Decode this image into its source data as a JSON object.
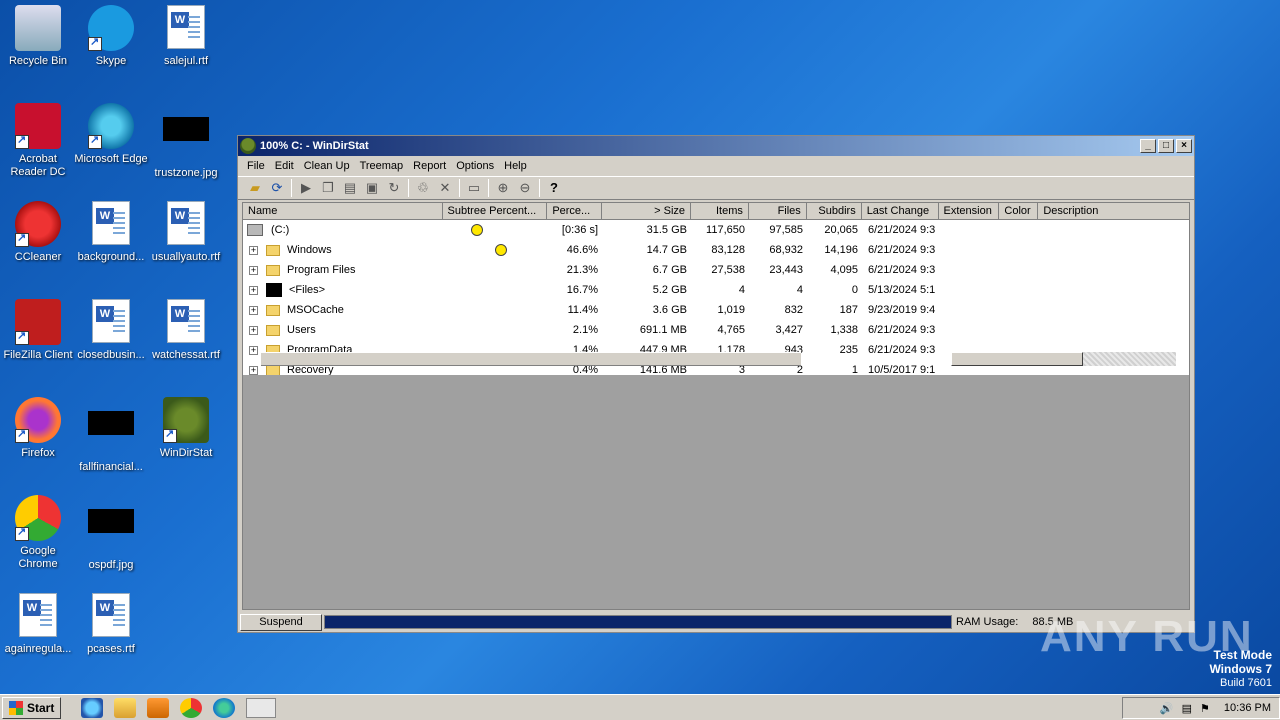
{
  "desktop_icons": [
    {
      "label": "Recycle Bin",
      "icon": "recycle-bin-icon"
    },
    {
      "label": "Skype",
      "icon": "skype-icon"
    },
    {
      "label": "salejul.rtf",
      "icon": "word-doc-icon"
    },
    {
      "label": "Acrobat Reader DC",
      "icon": "acrobat-icon"
    },
    {
      "label": "Microsoft Edge",
      "icon": "edge-icon"
    },
    {
      "label": "trustzone.jpg",
      "icon": "image-icon"
    },
    {
      "label": "CCleaner",
      "icon": "ccleaner-icon"
    },
    {
      "label": "background...",
      "icon": "word-doc-icon"
    },
    {
      "label": "usuallyauto.rtf",
      "icon": "word-doc-icon"
    },
    {
      "label": "FileZilla Client",
      "icon": "filezilla-icon"
    },
    {
      "label": "closedbusin...",
      "icon": "word-doc-icon"
    },
    {
      "label": "watchessat.rtf",
      "icon": "word-doc-icon"
    },
    {
      "label": "Firefox",
      "icon": "firefox-icon"
    },
    {
      "label": "fallfinancial...",
      "icon": "image-icon"
    },
    {
      "label": "WinDirStat",
      "icon": "windirstat-icon"
    },
    {
      "label": "Google Chrome",
      "icon": "chrome-icon"
    },
    {
      "label": "ospdf.jpg",
      "icon": "image-icon"
    },
    {
      "label": "againregula...",
      "icon": "word-doc-icon"
    },
    {
      "label": "pcases.rtf",
      "icon": "word-doc-icon"
    }
  ],
  "window": {
    "title": "100% C: - WinDirStat",
    "menu": [
      "File",
      "Edit",
      "Clean Up",
      "Treemap",
      "Report",
      "Options",
      "Help"
    ],
    "columns": [
      "Name",
      "Subtree Percent...",
      "Perce...",
      "> Size",
      "Items",
      "Files",
      "Subdirs",
      "Last Change",
      "Extension",
      "Color",
      "Description"
    ],
    "rows": [
      {
        "name": "(C:)",
        "expand": "",
        "perc": "[0:36 s]",
        "size": "31.5 GB",
        "items": "117,650",
        "files": "97,585",
        "subdirs": "20,065",
        "changed": "6/21/2024  9:3",
        "fill": 100
      },
      {
        "name": "Windows",
        "expand": "+",
        "perc": "46.6%",
        "size": "14.7 GB",
        "items": "83,128",
        "files": "68,932",
        "subdirs": "14,196",
        "changed": "6/21/2024  9:3",
        "fill": 46.6
      },
      {
        "name": "Program Files",
        "expand": "+",
        "perc": "21.3%",
        "size": "6.7 GB",
        "items": "27,538",
        "files": "23,443",
        "subdirs": "4,095",
        "changed": "6/21/2024  9:3",
        "fill": 21.3
      },
      {
        "name": "<Files>",
        "expand": "+",
        "perc": "16.7%",
        "size": "5.2 GB",
        "items": "4",
        "files": "4",
        "subdirs": "0",
        "changed": "5/13/2024  5:1",
        "fill": 16.7
      },
      {
        "name": "MSOCache",
        "expand": "+",
        "perc": "11.4%",
        "size": "3.6 GB",
        "items": "1,019",
        "files": "832",
        "subdirs": "187",
        "changed": "9/23/2019  9:4",
        "fill": 11.4
      },
      {
        "name": "Users",
        "expand": "+",
        "perc": "2.1%",
        "size": "691.1 MB",
        "items": "4,765",
        "files": "3,427",
        "subdirs": "1,338",
        "changed": "6/21/2024  9:3",
        "fill": 2.1
      },
      {
        "name": "ProgramData",
        "expand": "+",
        "perc": "1.4%",
        "size": "447.9 MB",
        "items": "1,178",
        "files": "943",
        "subdirs": "235",
        "changed": "6/21/2024  9:3",
        "fill": 1.4
      },
      {
        "name": "Recovery",
        "expand": "+",
        "perc": "0.4%",
        "size": "141.6 MB",
        "items": "3",
        "files": "2",
        "subdirs": "1",
        "changed": "10/5/2017  9:1",
        "fill": 0.4
      }
    ],
    "status": {
      "suspend_label": "Suspend",
      "ram_label": "RAM Usage:",
      "ram_value": "88.5 MB"
    }
  },
  "taskbar": {
    "start_label": "Start",
    "clock": "10:36 PM"
  },
  "watermark": {
    "line1": "Test Mode",
    "line2": "Windows 7",
    "line3": "Build 7601",
    "brand": "ANY RUN"
  }
}
